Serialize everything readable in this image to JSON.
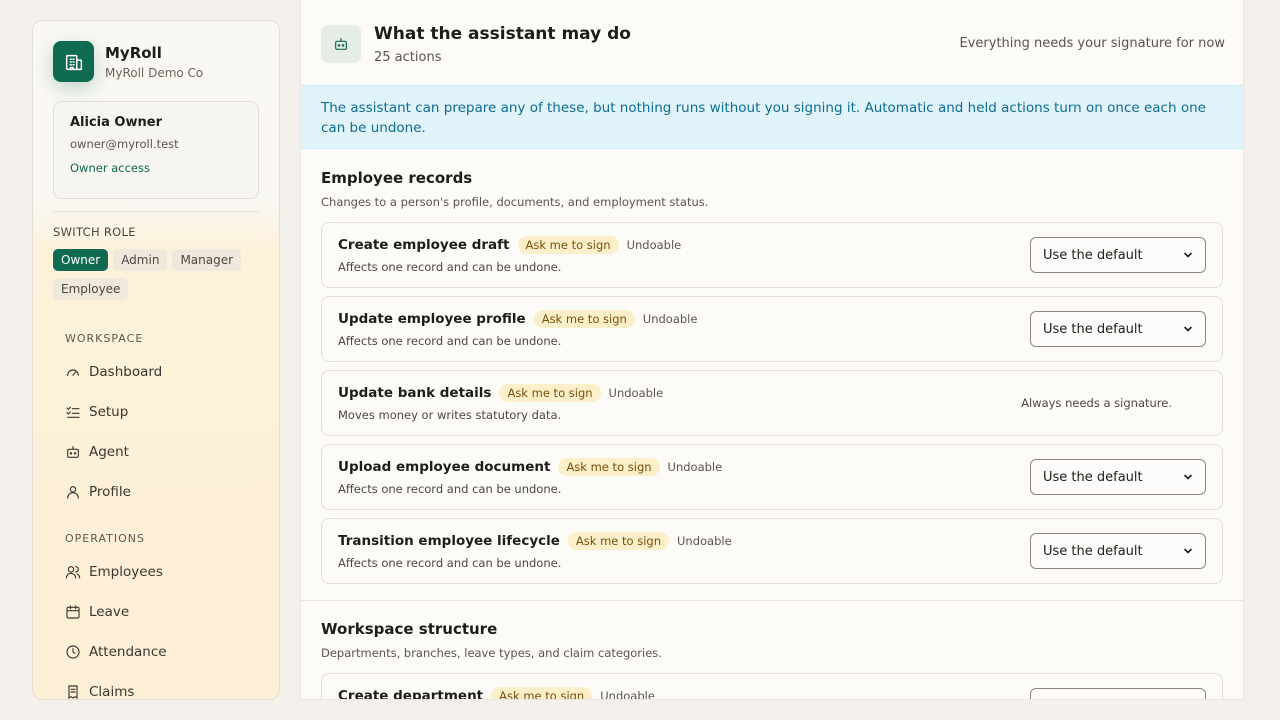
{
  "brand": {
    "name": "MyRoll",
    "org": "MyRoll Demo Co"
  },
  "user": {
    "name": "Alicia Owner",
    "email": "owner@myroll.test",
    "access": "Owner access"
  },
  "switch_role": {
    "label": "SWITCH ROLE",
    "roles": [
      "Owner",
      "Admin",
      "Manager",
      "Employee"
    ],
    "active": "Owner"
  },
  "nav": {
    "workspace_label": "WORKSPACE",
    "workspace": [
      {
        "label": "Dashboard",
        "icon": "gauge-icon"
      },
      {
        "label": "Setup",
        "icon": "checklist-icon"
      },
      {
        "label": "Agent",
        "icon": "robot-icon"
      },
      {
        "label": "Profile",
        "icon": "person-icon"
      }
    ],
    "operations_label": "OPERATIONS",
    "operations": [
      {
        "label": "Employees",
        "icon": "people-icon"
      },
      {
        "label": "Leave",
        "icon": "calendar-icon"
      },
      {
        "label": "Attendance",
        "icon": "clock-icon"
      },
      {
        "label": "Claims",
        "icon": "receipt-icon"
      }
    ]
  },
  "header": {
    "title": "What the assistant may do",
    "count": "25 actions",
    "note": "Everything needs your signature for now"
  },
  "banner": "The assistant can prepare any of these, but nothing runs without you signing it. Automatic and held actions turn on once each one can be undone.",
  "sections": [
    {
      "title": "Employee records",
      "subtitle": "Changes to a person's profile, documents, and employment status.",
      "actions": [
        {
          "title": "Create employee draft",
          "badge": "Ask me to sign",
          "tag": "Undoable",
          "desc": "Affects one record and can be undone.",
          "select": "Use the default"
        },
        {
          "title": "Update employee profile",
          "badge": "Ask me to sign",
          "tag": "Undoable",
          "desc": "Affects one record and can be undone.",
          "select": "Use the default"
        },
        {
          "title": "Update bank details",
          "badge": "Ask me to sign",
          "tag": "Undoable",
          "desc": "Moves money or writes statutory data.",
          "note": "Always needs a signature."
        },
        {
          "title": "Upload employee document",
          "badge": "Ask me to sign",
          "tag": "Undoable",
          "desc": "Affects one record and can be undone.",
          "select": "Use the default"
        },
        {
          "title": "Transition employee lifecycle",
          "badge": "Ask me to sign",
          "tag": "Undoable",
          "desc": "Affects one record and can be undone.",
          "select": "Use the default"
        }
      ]
    },
    {
      "title": "Workspace structure",
      "subtitle": "Departments, branches, leave types, and claim categories.",
      "actions": [
        {
          "title": "Create department",
          "badge": "Ask me to sign",
          "tag": "Undoable",
          "desc": "",
          "select": ""
        }
      ]
    }
  ],
  "colors": {
    "brand": "#0e6b52",
    "banner_bg": "#e1f3fb",
    "banner_text": "#0d6d94",
    "badge_bg": "#fcefc9",
    "badge_text": "#7a4f08"
  }
}
